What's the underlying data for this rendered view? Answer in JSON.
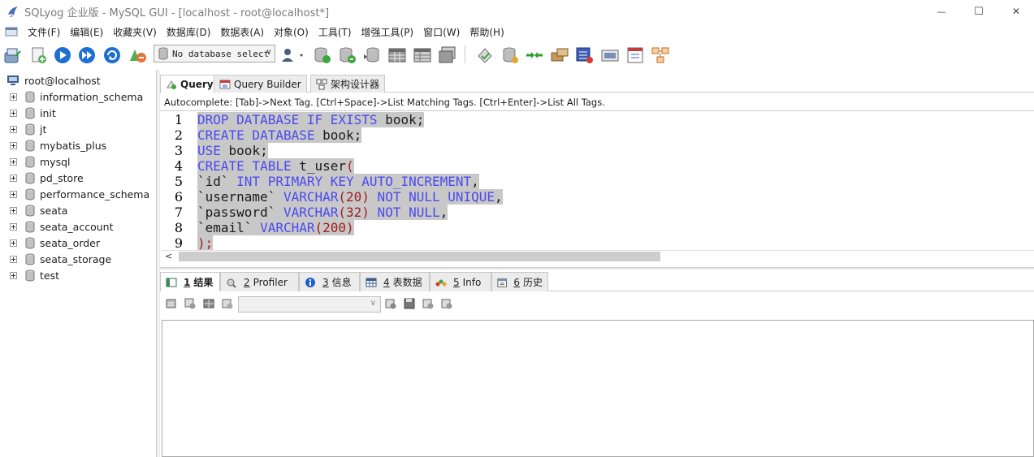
{
  "window": {
    "title": "SQLyog 企业版 - MySQL GUI - [localhost - root@localhost*]",
    "minimize_glyph": "—",
    "maximize_glyph": "☐",
    "close_glyph": "✕"
  },
  "menu": {
    "items": [
      "文件(F)",
      "编辑(E)",
      "收藏夹(V)",
      "数据库(D)",
      "数据表(A)",
      "对象(O)",
      "工具(T)",
      "增强工具(P)",
      "窗口(W)",
      "帮助(H)"
    ]
  },
  "toolbar": {
    "db_select": "No database select",
    "icons": [
      "new-connection-icon",
      "new-query-icon",
      "execute-icon",
      "execute-all-icon",
      "refresh-icon",
      "schema-icon",
      "user-manager-icon",
      "backup-icon",
      "restore-icon",
      "import-icon",
      "table-data-icon",
      "table-structure-icon",
      "table-copy-icon",
      "sync-icon",
      "db-sync-icon",
      "migrate-icon",
      "schema-sync-icon",
      "job-agent-icon",
      "notifications-icon",
      "query-profiler-icon",
      "schema-designer-icon"
    ]
  },
  "tree": {
    "root": "root@localhost",
    "databases": [
      "information_schema",
      "init",
      "jt",
      "mybatis_plus",
      "mysql",
      "pd_store",
      "performance_schema",
      "seata",
      "seata_account",
      "seata_order",
      "seata_storage",
      "test"
    ]
  },
  "editor": {
    "tabs": [
      "Query",
      "Query Builder",
      "架构设计器"
    ],
    "autocomplete_hint": "Autocomplete: [Tab]->Next Tag. [Ctrl+Space]->List Matching Tags. [Ctrl+Enter]->List All Tags.",
    "lines": [
      {
        "n": "1",
        "tokens": [
          {
            "t": "DROP DATABASE IF EXISTS",
            "c": "kw"
          },
          {
            "t": " book;",
            "c": "id"
          }
        ]
      },
      {
        "n": "2",
        "tokens": [
          {
            "t": "CREATE DATABASE",
            "c": "kw"
          },
          {
            "t": " book;",
            "c": "id"
          }
        ]
      },
      {
        "n": "3",
        "tokens": [
          {
            "t": "USE",
            "c": "kw"
          },
          {
            "t": " book;",
            "c": "id"
          }
        ]
      },
      {
        "n": "4",
        "tokens": [
          {
            "t": "CREATE TABLE",
            "c": "kw"
          },
          {
            "t": " t_user",
            "c": "id"
          },
          {
            "t": "(",
            "c": "num"
          }
        ]
      },
      {
        "n": "5",
        "tokens": [
          {
            "t": "`id`",
            "c": "id"
          },
          {
            "t": " INT PRIMARY KEY AUTO_INCREMENT",
            "c": "kw"
          },
          {
            "t": ",",
            "c": "pun"
          }
        ]
      },
      {
        "n": "6",
        "tokens": [
          {
            "t": "`username`",
            "c": "id"
          },
          {
            "t": " VARCHAR",
            "c": "kw"
          },
          {
            "t": "(20)",
            "c": "num"
          },
          {
            "t": " NOT NULL UNIQUE",
            "c": "kw"
          },
          {
            "t": ",",
            "c": "pun"
          }
        ]
      },
      {
        "n": "7",
        "tokens": [
          {
            "t": "`password`",
            "c": "id"
          },
          {
            "t": " VARCHAR",
            "c": "kw"
          },
          {
            "t": "(32)",
            "c": "num"
          },
          {
            "t": " NOT NULL",
            "c": "kw"
          },
          {
            "t": ",",
            "c": "pun"
          }
        ]
      },
      {
        "n": "8",
        "tokens": [
          {
            "t": "`email`",
            "c": "id"
          },
          {
            "t": " VARCHAR",
            "c": "kw"
          },
          {
            "t": "(200)",
            "c": "num"
          }
        ]
      },
      {
        "n": "9",
        "tokens": [
          {
            "t": ");",
            "c": "num"
          }
        ]
      }
    ]
  },
  "results": {
    "tabs": [
      {
        "key": "1",
        "label": "结果"
      },
      {
        "key": "2",
        "label": "Profiler"
      },
      {
        "key": "3",
        "label": "信息"
      },
      {
        "key": "4",
        "label": "表数据"
      },
      {
        "key": "5",
        "label": "Info"
      },
      {
        "key": "6",
        "label": "历史"
      }
    ],
    "combo_value": ""
  },
  "colors": {
    "keyword": "#4a4af0",
    "number": "#a01d1d",
    "selection": "#c8c8c8",
    "border": "#c9c9c9"
  }
}
